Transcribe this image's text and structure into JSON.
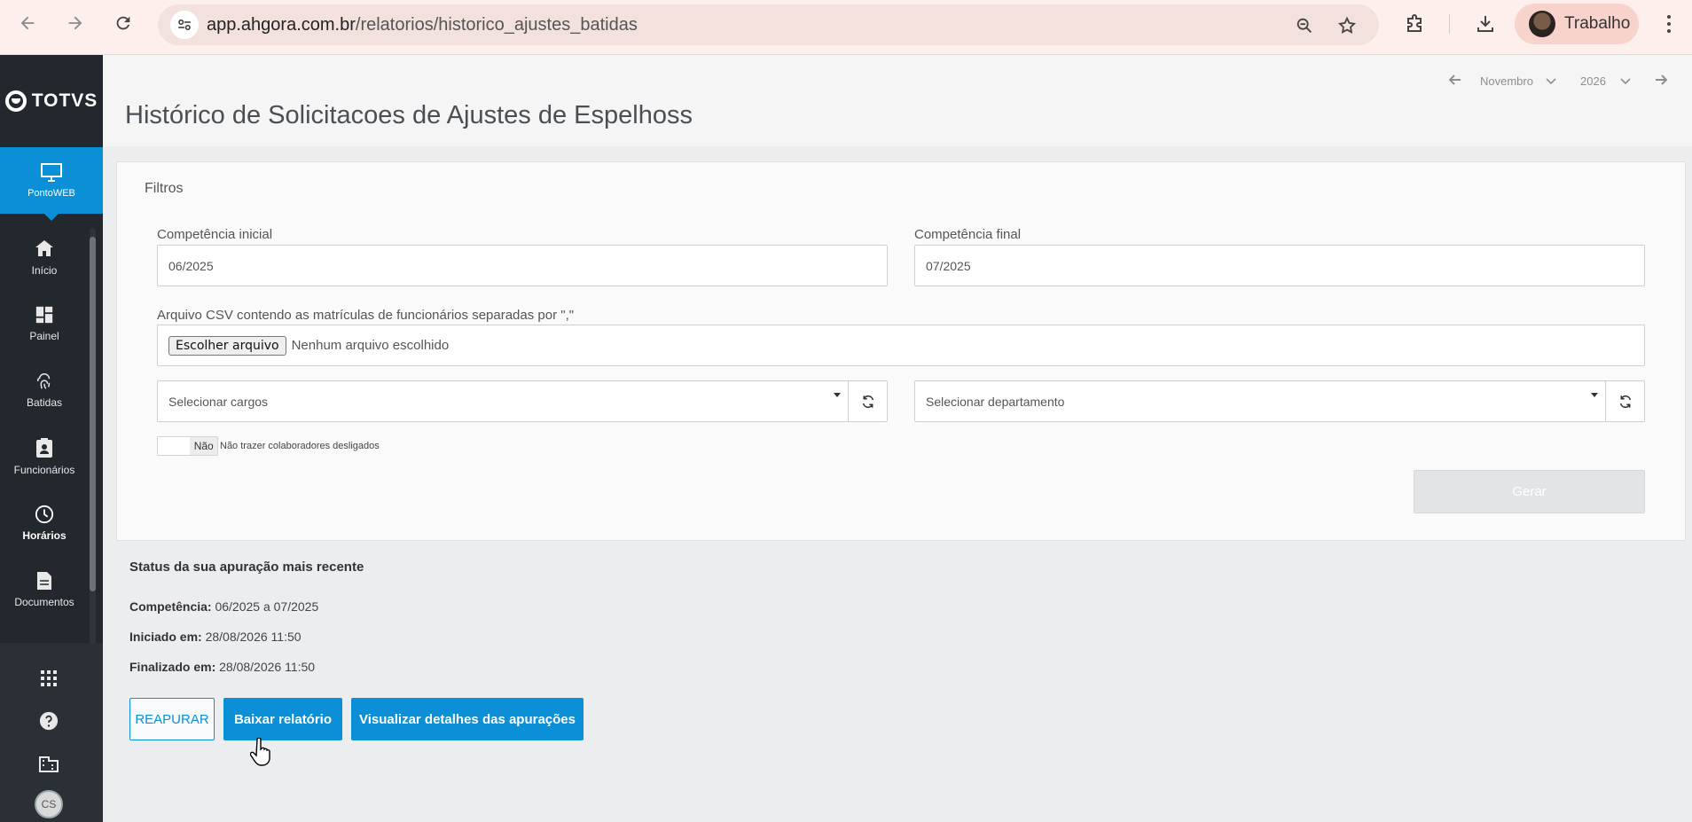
{
  "browser": {
    "url_host": "app.ahgora.com.br",
    "url_path": "/relatorios/historico_ajustes_batidas",
    "profile_label": "Trabalho"
  },
  "sidebar": {
    "logo": "TOTVS",
    "module": "PontoWEB",
    "items": [
      {
        "label": "Início",
        "icon": "home-icon"
      },
      {
        "label": "Painel",
        "icon": "dashboard-icon"
      },
      {
        "label": "Batidas",
        "icon": "fingerprint-icon"
      },
      {
        "label": "Funcionários",
        "icon": "badge-icon"
      },
      {
        "label": "Horários",
        "icon": "clock-icon"
      },
      {
        "label": "Documentos",
        "icon": "document-icon"
      }
    ],
    "user_initials": "CS"
  },
  "header": {
    "title": "Histórico de Solicitacoes de Ajustes de Espelhoss",
    "month": "Novembro",
    "year": "2026"
  },
  "filters": {
    "title": "Filtros",
    "start_label": "Competência inicial",
    "start_value": "06/2025",
    "end_label": "Competência final",
    "end_value": "07/2025",
    "csv_label": "Arquivo CSV contendo as matrículas de funcionários separadas por \",\"",
    "file_button": "Escolher arquivo",
    "file_none": "Nenhum arquivo escolhido",
    "roles_placeholder": "Selecionar cargos",
    "dept_placeholder": "Selecionar departamento",
    "toggle_value": "Não",
    "toggle_text": "Não trazer colaboradores desligados",
    "generate_button": "Gerar"
  },
  "status": {
    "title": "Status da sua apuração mais recente",
    "competencia_label": "Competência:",
    "competencia_value": "06/2025 a 07/2025",
    "iniciado_label": "Iniciado em:",
    "iniciado_value": "28/08/2026 11:50",
    "finalizado_label": "Finalizado em:",
    "finalizado_value": "28/08/2026 11:50"
  },
  "actions": {
    "reapurar": "REAPURAR",
    "baixar": "Baixar relatório",
    "detalhes": "Visualizar detalhes das apurações"
  },
  "colors": {
    "accent": "#0b8fd6",
    "sidebar": "#23272e",
    "chrome": "#fcefec"
  }
}
